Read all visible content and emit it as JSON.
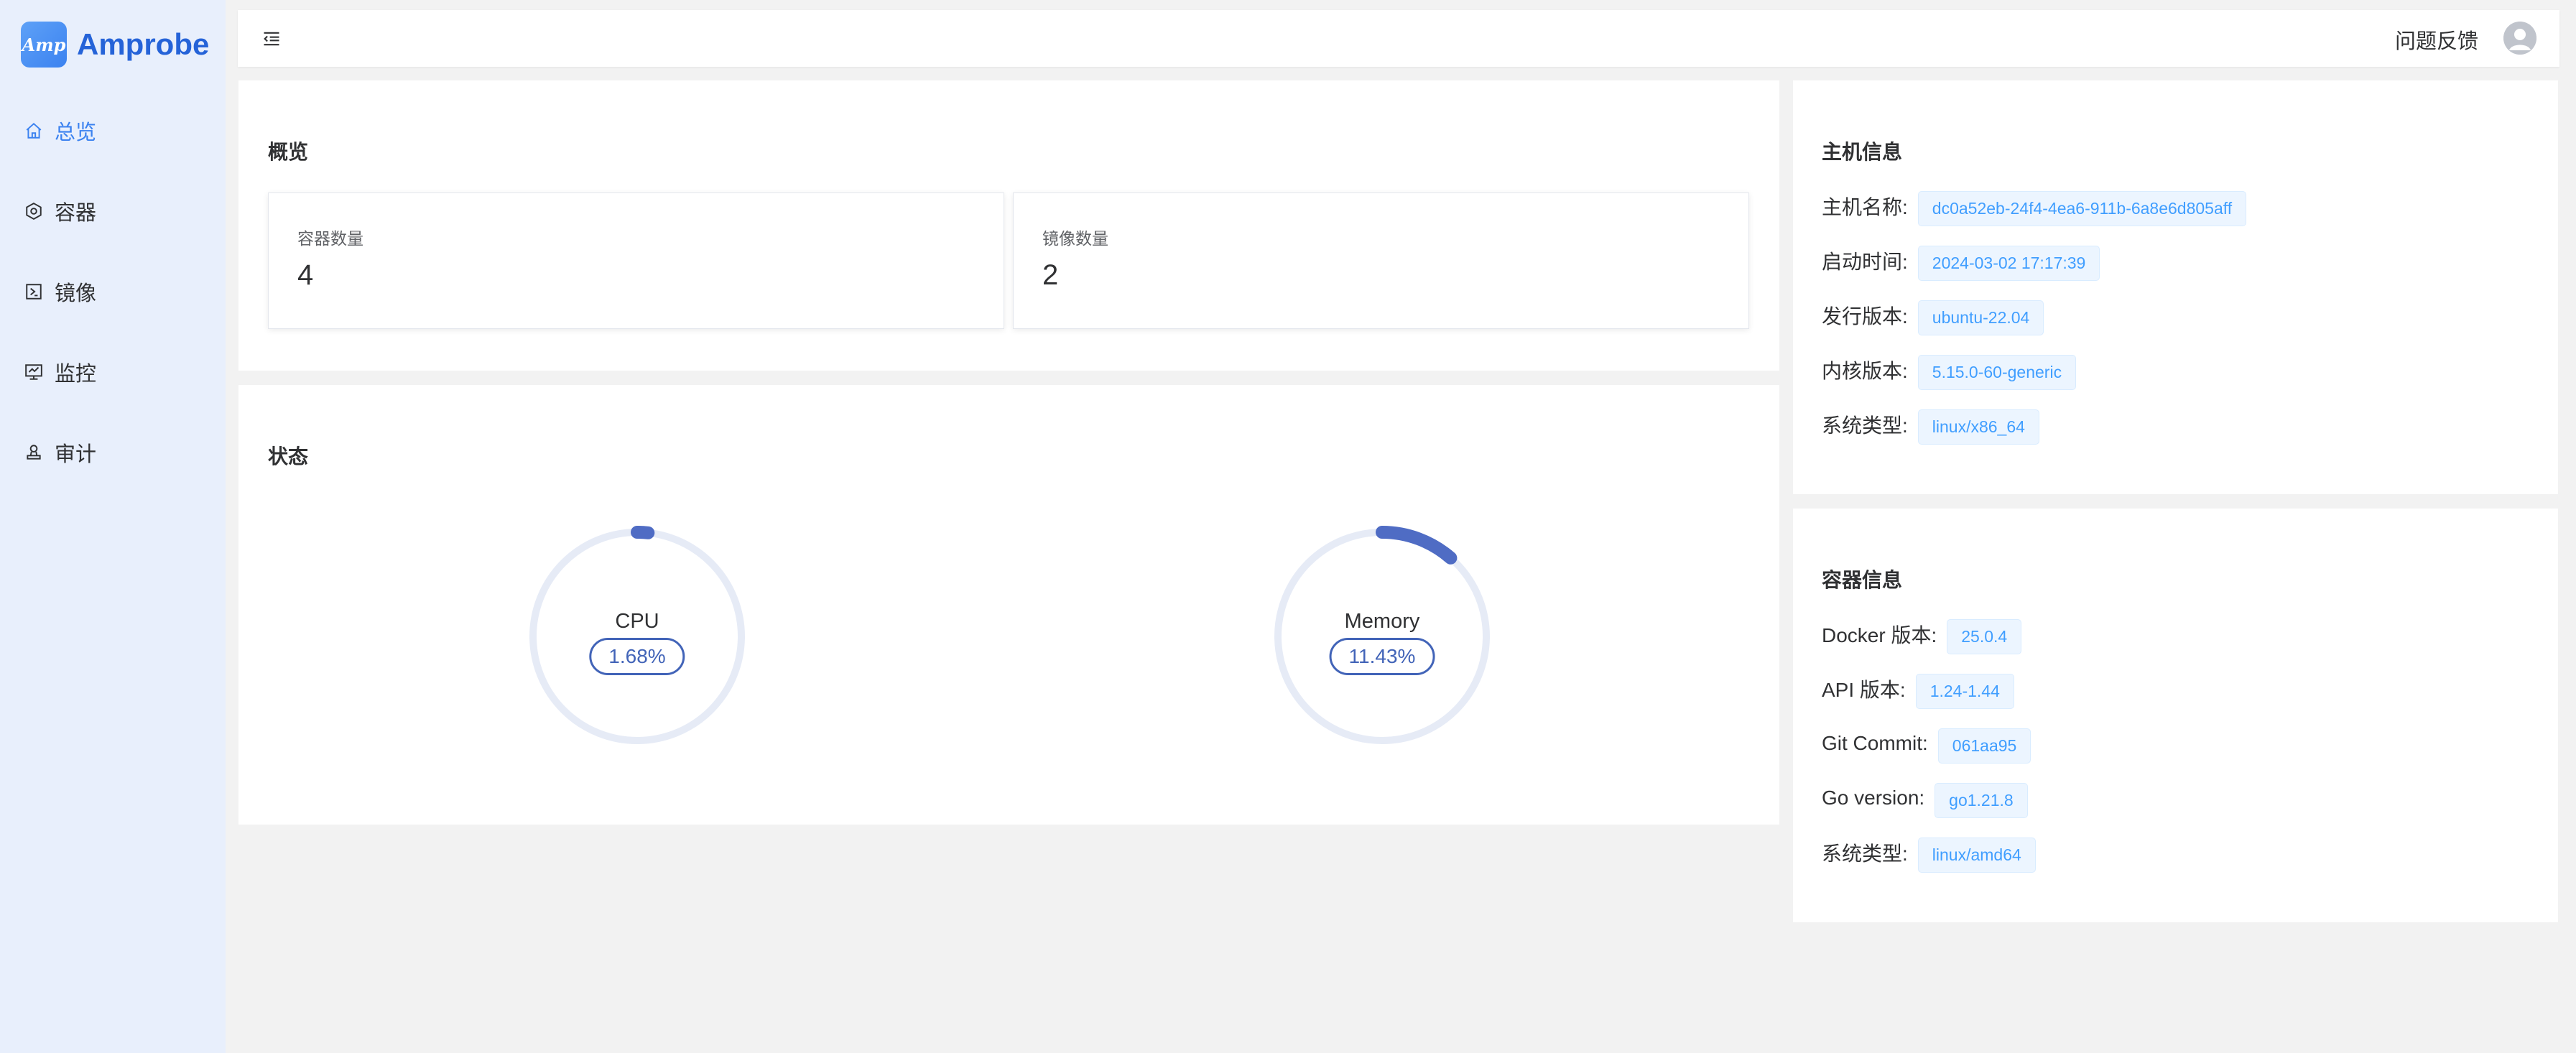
{
  "brand": {
    "logo_text": "Amp",
    "name": "Amprobe"
  },
  "sidebar": {
    "items": [
      {
        "label": "总览",
        "icon": "home-icon",
        "active": true
      },
      {
        "label": "容器",
        "icon": "container-icon",
        "active": false
      },
      {
        "label": "镜像",
        "icon": "image-icon",
        "active": false
      },
      {
        "label": "监控",
        "icon": "monitor-icon",
        "active": false
      },
      {
        "label": "审计",
        "icon": "audit-icon",
        "active": false
      }
    ]
  },
  "header": {
    "feedback": "问题反馈"
  },
  "overview": {
    "title": "概览",
    "stats": [
      {
        "label": "容器数量",
        "value": "4"
      },
      {
        "label": "镜像数量",
        "value": "2"
      }
    ]
  },
  "status": {
    "title": "状态",
    "gauges": [
      {
        "label": "CPU",
        "value": "1.68%",
        "percent": 1.68
      },
      {
        "label": "Memory",
        "value": "11.43%",
        "percent": 11.43
      }
    ]
  },
  "host": {
    "title": "主机信息",
    "rows": [
      {
        "label": "主机名称:",
        "value": "dc0a52eb-24f4-4ea6-911b-6a8e6d805aff"
      },
      {
        "label": "启动时间:",
        "value": "2024-03-02 17:17:39"
      },
      {
        "label": "发行版本:",
        "value": "ubuntu-22.04"
      },
      {
        "label": "内核版本:",
        "value": "5.15.0-60-generic"
      },
      {
        "label": "系统类型:",
        "value": "linux/x86_64"
      }
    ]
  },
  "container": {
    "title": "容器信息",
    "rows": [
      {
        "label": "Docker 版本:",
        "value": "25.0.4"
      },
      {
        "label": "API 版本:",
        "value": "1.24-1.44"
      },
      {
        "label": "Git Commit:",
        "value": "061aa95"
      },
      {
        "label": "Go version:",
        "value": "go1.21.8"
      },
      {
        "label": "系统类型:",
        "value": "linux/amd64"
      }
    ]
  },
  "colors": {
    "accent": "#3b82f0",
    "gauge_fill": "#4f6cc4",
    "gauge_track": "#e6ebf6",
    "tag_text": "#409eff"
  }
}
